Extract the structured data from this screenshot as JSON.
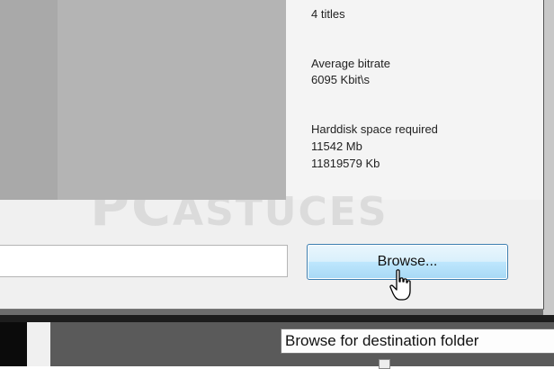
{
  "info": {
    "titles": "4 titles",
    "bitrate_label": "Average bitrate",
    "bitrate_value": "6095 Kbit\\s",
    "space_label": "Harddisk space required",
    "space_mb": "11542 Mb",
    "space_kb": "11819579 Kb"
  },
  "destination": {
    "path_value": "",
    "browse_label": "Browse...",
    "tooltip": "Browse for destination folder"
  },
  "watermark": {
    "part1": "PC",
    "part2": "ASTUCES"
  },
  "colors": {
    "button_border": "#3c7fb1",
    "dialog_bg": "#f0f0f0",
    "tooltip_bg": "#fdfdfd"
  },
  "icons": {
    "cursor": "hand-pointer-icon",
    "checkbox": "checkbox-icon"
  }
}
